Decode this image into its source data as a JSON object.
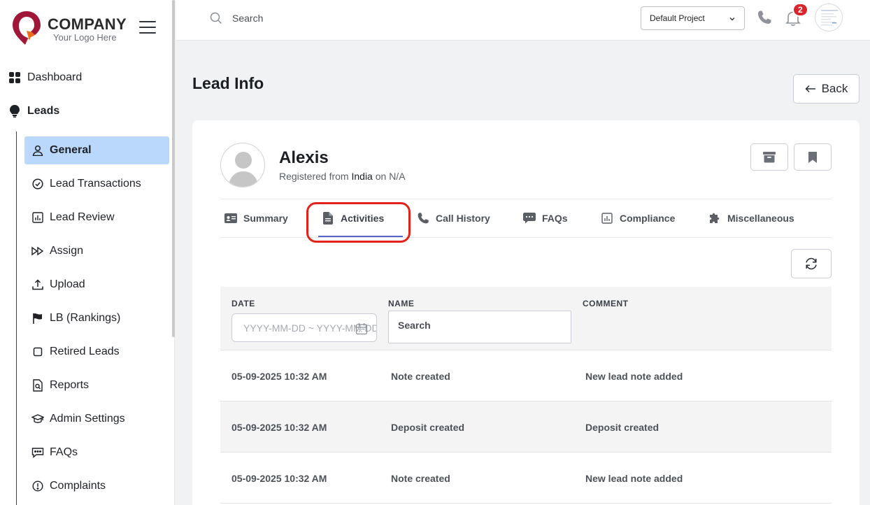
{
  "brand": {
    "title": "COMPANY",
    "subtitle": "Your Logo Here",
    "colors": {
      "primary": "#a0173a",
      "accent": "#ef6c1a"
    }
  },
  "sidebar": {
    "top_items": [
      {
        "label": "Dashboard",
        "icon": "grid-icon"
      },
      {
        "label": "Leads",
        "icon": "lightbulb-icon"
      }
    ],
    "sub_items": [
      {
        "label": "General",
        "icon": "user-icon",
        "active": true
      },
      {
        "label": "Lead Transactions",
        "icon": "check-circle-icon"
      },
      {
        "label": "Lead Review",
        "icon": "bar-chart-icon"
      },
      {
        "label": "Assign",
        "icon": "fast-forward-icon"
      },
      {
        "label": "Upload",
        "icon": "upload-icon"
      },
      {
        "label": "LB (Rankings)",
        "icon": "flag-icon"
      },
      {
        "label": "Retired Leads",
        "icon": "square-icon"
      },
      {
        "label": "Reports",
        "icon": "document-search-icon"
      },
      {
        "label": "Admin Settings",
        "icon": "graduation-cap-icon"
      },
      {
        "label": "FAQs",
        "icon": "chat-icon"
      },
      {
        "label": "Complaints",
        "icon": "info-circle-icon"
      }
    ]
  },
  "topbar": {
    "search_placeholder": "Search",
    "project": "Default Project",
    "notification_count": "2"
  },
  "page": {
    "title": "Lead Info",
    "back_label": "Back"
  },
  "lead": {
    "name": "Alexis",
    "registered_prefix": "Registered from",
    "country": "India",
    "on_text": "on N/A"
  },
  "tabs": [
    {
      "label": "Summary",
      "icon": "id-card-icon"
    },
    {
      "label": "Activities",
      "icon": "file-text-icon",
      "active": true
    },
    {
      "label": "Call History",
      "icon": "phone-icon"
    },
    {
      "label": "FAQs",
      "icon": "comment-icon"
    },
    {
      "label": "Compliance",
      "icon": "bar-chart-icon"
    },
    {
      "label": "Miscellaneous",
      "icon": "puzzle-icon"
    }
  ],
  "table": {
    "headers": {
      "date": "DATE",
      "name": "NAME",
      "comment": "COMMENT"
    },
    "date_placeholder": "YYYY-MM-DD ~ YYYY-MM-DD",
    "name_filter": "Search",
    "rows": [
      {
        "date": "05-09-2025 10:32 AM",
        "name": "Note created",
        "comment": "New lead note added"
      },
      {
        "date": "05-09-2025 10:32 AM",
        "name": "Deposit created",
        "comment": "Deposit created"
      },
      {
        "date": "05-09-2025 10:32 AM",
        "name": "Note created",
        "comment": "New lead note added"
      }
    ]
  },
  "colors": {
    "active_nav_bg": "#b9d8fb",
    "tab_underline": "#5a63c9",
    "highlight": "#e4221c",
    "badge": "#d9252b"
  }
}
